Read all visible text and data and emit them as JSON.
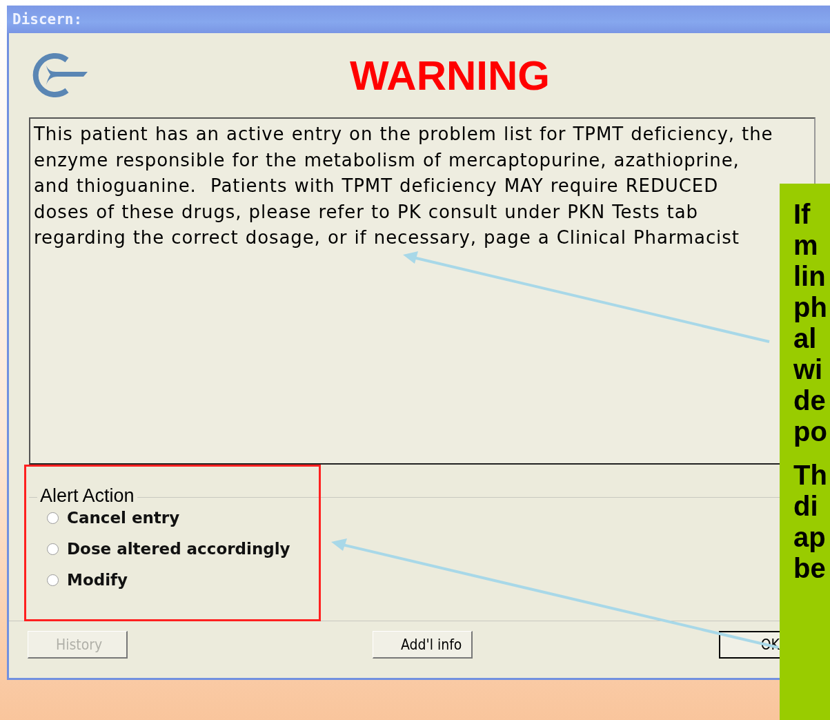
{
  "window": {
    "title": "Discern:"
  },
  "heading": "WARNING",
  "message": {
    "lines": [
      "This patient has an active entry on the problem list for TPMT deficiency, the",
      "enzyme responsible for the metabolism of mercaptopurine, azathioprine,",
      "and thioguanine.  Patients with TPMT deficiency MAY require REDUCED",
      "doses of these drugs, please refer to PK consult under PKN Tests tab",
      "regarding the correct dosage, or if necessary, page a Clinical Pharmacist"
    ]
  },
  "alert_action": {
    "label": "Alert Action",
    "options": [
      {
        "label": "Cancel entry",
        "selected": false
      },
      {
        "label": "Dose altered accordingly",
        "selected": false
      },
      {
        "label": "Modify",
        "selected": false
      }
    ]
  },
  "buttons": [
    {
      "label": "History",
      "disabled": true,
      "default": false
    },
    {
      "label": "Add'l info",
      "disabled": false,
      "default": false
    },
    {
      "label": "OK",
      "disabled": false,
      "default": true
    }
  ],
  "callout": {
    "paragraphs": [
      [
        "If",
        "m",
        "lin",
        "ph",
        "al",
        "wi",
        "de",
        "po"
      ],
      [
        "Th",
        "di",
        "ap",
        "be"
      ]
    ]
  }
}
